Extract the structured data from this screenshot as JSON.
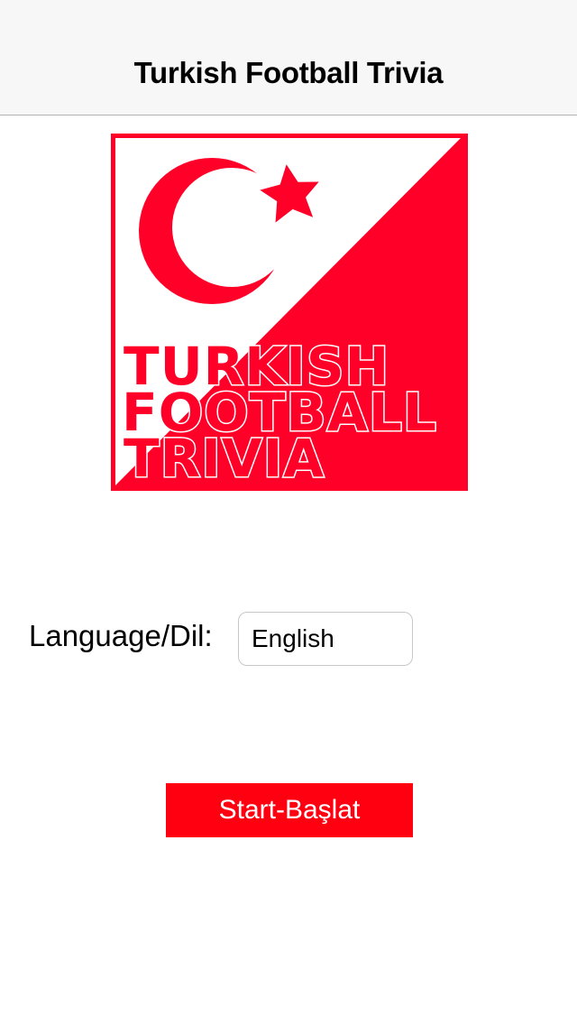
{
  "navbar": {
    "title": "Turkish Football Trivia"
  },
  "logo": {
    "lines": [
      "TURKISH",
      "FOOTBALL",
      "TRIVIA"
    ],
    "colors": {
      "red": "#ff0028",
      "white": "#ffffff"
    },
    "icons": [
      "crescent-icon",
      "star-icon"
    ]
  },
  "language": {
    "label": "Language/Dil:",
    "value": "English"
  },
  "start_button": {
    "label": "Start-Başlat",
    "color": "#ff0010"
  }
}
